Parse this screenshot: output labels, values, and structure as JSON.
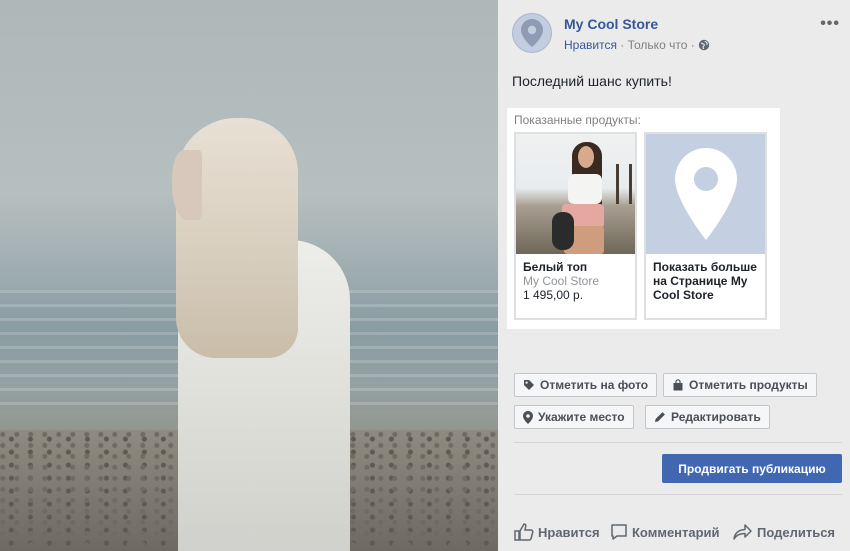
{
  "post": {
    "store_name": "My Cool Store",
    "like_link": "Нравится",
    "separator": " · ",
    "time": "Только что",
    "separator2": " · ",
    "text": "Последний шанс купить!",
    "more_icon": "more-icon"
  },
  "products": {
    "label": "Показанные продукты:",
    "items": [
      {
        "title": "Белый топ",
        "store": "My Cool Store",
        "price": "1 495,00 р."
      },
      {
        "title": "Показать больше на Странице My Cool Store"
      }
    ]
  },
  "toolbar": {
    "tag_photo": "Отметить на фото",
    "tag_products": "Отметить продукты",
    "location": "Укажите место",
    "edit": "Редактировать",
    "promote": "Продвигать публикацию"
  },
  "actions": {
    "like": "Нравится",
    "comment": "Комментарий",
    "share": "Поделиться"
  },
  "colors": {
    "link": "#365899",
    "promote_bg": "#4267b2",
    "panel_bg": "#ebebec"
  }
}
